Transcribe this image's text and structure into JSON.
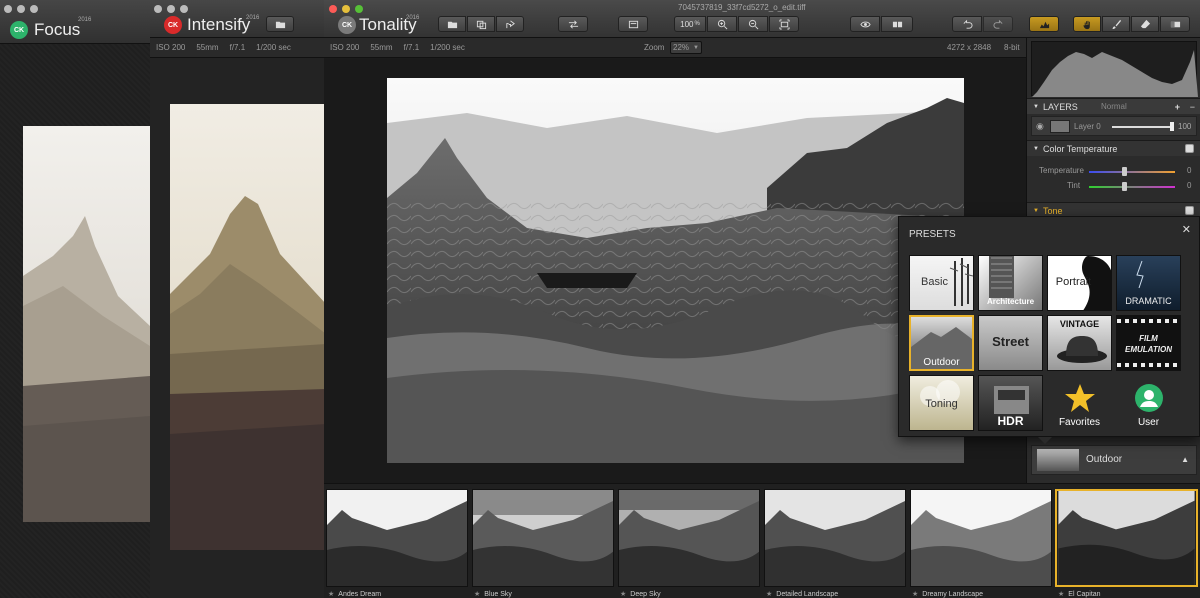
{
  "windows": {
    "focus": {
      "title": "Focus",
      "year": "2016",
      "badge": "CK"
    },
    "intensify": {
      "title": "Intensify",
      "year": "2016",
      "badge": "CK",
      "info": [
        "ISO 200",
        "55mm",
        "f/7.1",
        "1/200 sec"
      ]
    },
    "tonality": {
      "title": "Tonality",
      "year": "2016",
      "badge": "CK",
      "filename": "7045737819_33f7cd5272_o_edit.tiff",
      "info": [
        "ISO 200",
        "55mm",
        "f/7.1",
        "1/200 sec"
      ],
      "zoom_label": "Zoom",
      "zoom_value": "22%",
      "zoom_percent": "100",
      "zoom_percent_sign": "%",
      "dimensions": "4272 x 2848",
      "bit_depth": "8-bit"
    }
  },
  "right_panel": {
    "layers": {
      "title": "LAYERS",
      "blend_mode": "Normal",
      "layer_name": "Layer 0",
      "opacity": "100",
      "opacity_fraction": 1.0,
      "add_label": "+",
      "remove_label": "−"
    },
    "color_temperature": {
      "title": "Color Temperature",
      "temperature_label": "Temperature",
      "temperature_value": "0",
      "tint_label": "Tint",
      "tint_value": "0"
    },
    "tone": {
      "title": "Tone"
    },
    "current_preset": "Outdoor",
    "current_preset_arrow": "▲"
  },
  "presets_popup": {
    "title": "PRESETS",
    "close": "✕",
    "items": [
      {
        "label": "Basic"
      },
      {
        "label": "Architecture"
      },
      {
        "label": "Portrait"
      },
      {
        "label": "DRAMATIC"
      },
      {
        "label": "Outdoor",
        "selected": true
      },
      {
        "label": "Street"
      },
      {
        "label": "VINTAGE"
      },
      {
        "label": "FILM EMULATION"
      },
      {
        "label": "Toning"
      },
      {
        "label": "HDR"
      },
      {
        "label": "Favorites"
      },
      {
        "label": "User"
      }
    ],
    "accent": "#e8b22a",
    "user_color": "#2db36b"
  },
  "filmstrip": [
    {
      "label": "Andes Dream"
    },
    {
      "label": "Blue Sky"
    },
    {
      "label": "Deep Sky"
    },
    {
      "label": "Detailed Landscape"
    },
    {
      "label": "Dreamy Landscape"
    },
    {
      "label": "El Capitan",
      "selected": true
    }
  ],
  "colors": {
    "focus_badge": "#2db36b",
    "intensify_badge": "#d92a2a",
    "tonality_badge": "#7a7a7a",
    "selection": "#e8b22a"
  }
}
